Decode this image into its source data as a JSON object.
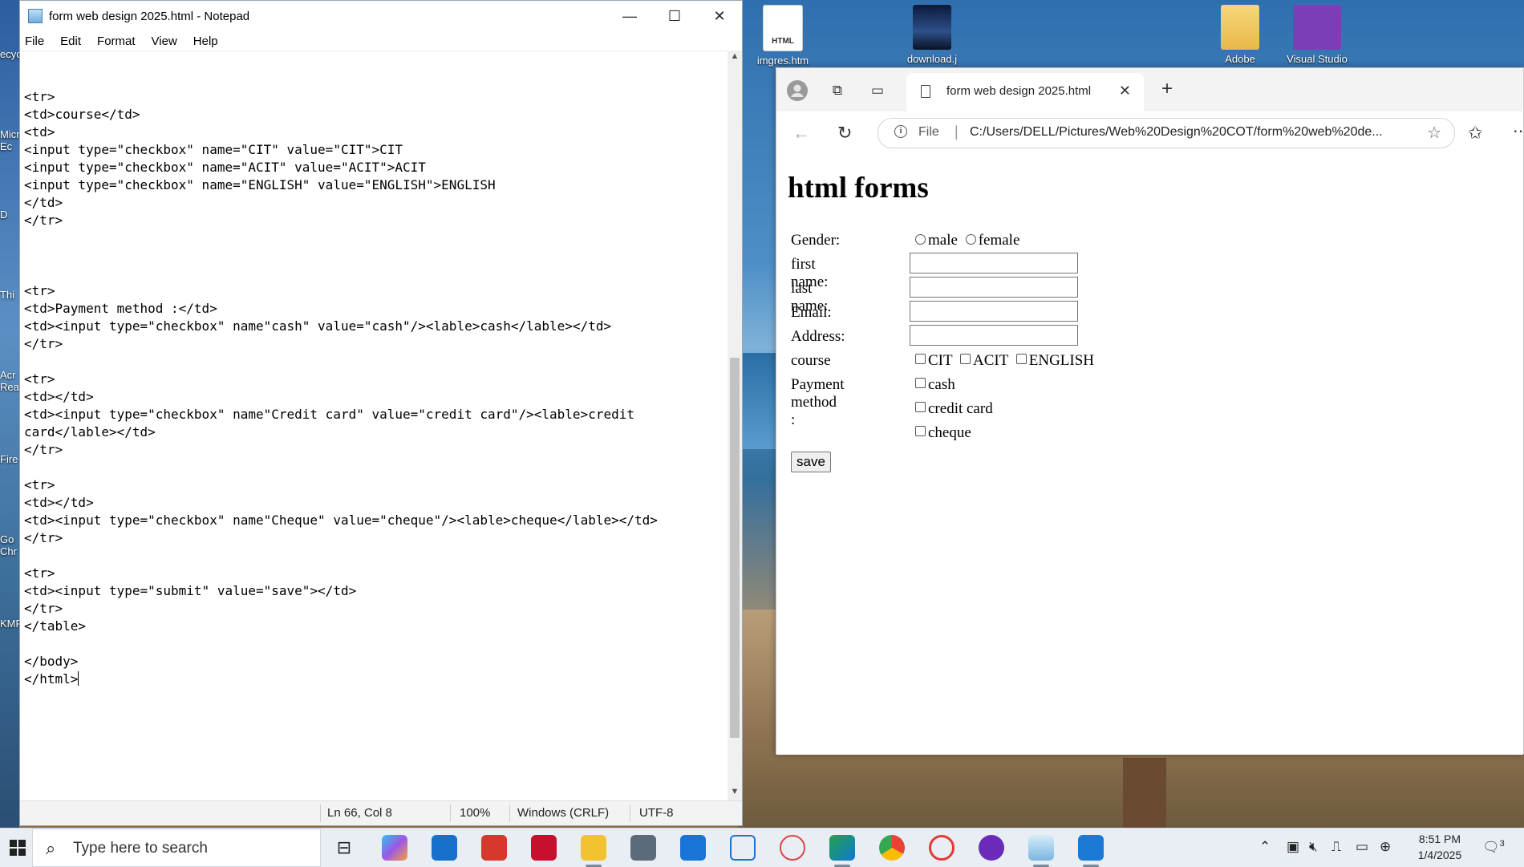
{
  "desktop": {
    "icons": [
      {
        "label": "imgres.htm"
      },
      {
        "label": "download.j"
      },
      {
        "label": "Adobe"
      },
      {
        "label": "Visual Studio"
      }
    ],
    "left_strip_labels": [
      "ecyc",
      "Micr Ec",
      "D",
      "Thi",
      "Acr Rea",
      "Fire",
      "Go Chr",
      "KMF"
    ],
    "html_badge": "HTML"
  },
  "notepad": {
    "title": "form web design 2025.html - Notepad",
    "menu": [
      "File",
      "Edit",
      "Format",
      "View",
      "Help"
    ],
    "code": "<tr>\n<td>course</td>\n<td>\n<input type=\"checkbox\" name=\"CIT\" value=\"CIT\">CIT\n<input type=\"checkbox\" name=\"ACIT\" value=\"ACIT\">ACIT\n<input type=\"checkbox\" name=\"ENGLISH\" value=\"ENGLISH\">ENGLISH\n</td>\n</tr>\n\n\n\n<tr>\n<td>Payment method :</td>\n<td><input type=\"checkbox\" name\"cash\" value=\"cash\"/><lable>cash</lable></td>\n</tr>\n\n<tr>\n<td></td>\n<td><input type=\"checkbox\" name\"Credit card\" value=\"credit card\"/><lable>credit\ncard</lable></td>\n</tr>\n\n<tr>\n<td></td>\n<td><input type=\"checkbox\" name\"Cheque\" value=\"cheque\"/><lable>cheque</lable></td>\n</tr>\n\n<tr>\n<td><input type=\"submit\" value=\"save\"></td>\n</tr>\n</table>\n\n</body>\n</html>",
    "status": {
      "position": "Ln 66, Col 8",
      "zoom": "100%",
      "line_ending": "Windows (CRLF)",
      "encoding": "UTF-8"
    },
    "window_buttons": {
      "minimize": "—",
      "maximize": "☐",
      "close": "✕"
    }
  },
  "browser": {
    "tab_title": "form web design 2025.html",
    "address_scheme": "File",
    "address": "C:/Users/DELL/Pictures/Web%20Design%20COT/form%20web%20de...",
    "page": {
      "heading": "html forms",
      "gender_label": "Gender:",
      "gender_options": [
        "male",
        "female"
      ],
      "first_name_label": "first name:",
      "last_name_label": "last name:",
      "email_label": "Email:",
      "address_label": "Address:",
      "course_label": "course",
      "course_options": [
        "CIT",
        "ACIT",
        "ENGLISH"
      ],
      "payment_label": "Payment method :",
      "payment_options": [
        "cash",
        "credit card",
        "cheque"
      ],
      "save_label": "save"
    }
  },
  "taskbar": {
    "search_placeholder": "Type here to search",
    "time": "8:51 PM",
    "date": "1/4/2025",
    "notification_count": "3"
  }
}
